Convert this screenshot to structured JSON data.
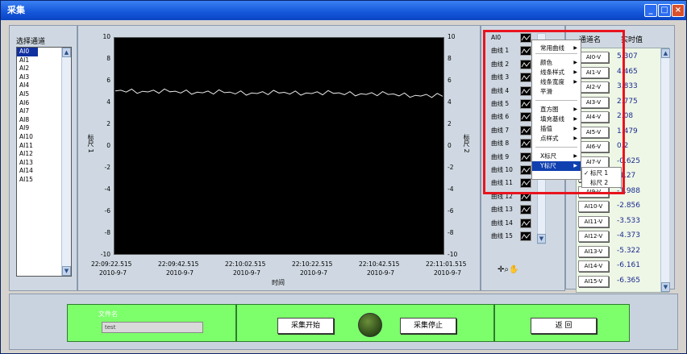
{
  "window": {
    "title": "采集"
  },
  "left": {
    "label": "选择通道",
    "channels": [
      "AI0",
      "AI1",
      "AI2",
      "AI3",
      "AI4",
      "AI5",
      "AI6",
      "AI7",
      "AI8",
      "AI9",
      "AI10",
      "AI11",
      "AI12",
      "AI13",
      "AI14",
      "AI15"
    ]
  },
  "chart": {
    "ylabel_left": "标尺 1",
    "ylabel_right": "标尺 2",
    "xlabel": "时间",
    "yticks": [
      "10",
      "8",
      "6",
      "4",
      "2",
      "0",
      "-2",
      "-4",
      "-6",
      "-8",
      "-10"
    ],
    "xticks": [
      {
        "time": "22:09:22.515",
        "date": "2010-9-7"
      },
      {
        "time": "22:09:42.515",
        "date": "2010-9-7"
      },
      {
        "time": "22:10:02.515",
        "date": "2010-9-7"
      },
      {
        "time": "22:10:22.515",
        "date": "2010-9-7"
      },
      {
        "time": "22:10:42.515",
        "date": "2010-9-7"
      },
      {
        "time": "22:11:01.515",
        "date": "2010-9-7"
      }
    ]
  },
  "chart_data": {
    "type": "line",
    "ylim": [
      -10,
      10
    ],
    "y2lim": [
      -10,
      10
    ],
    "xlabel": "时间",
    "ylabel": "标尺 1",
    "y2label": "标尺 2",
    "x": [
      "22:09:22.515",
      "22:09:42.515",
      "22:10:02.515",
      "22:10:22.515",
      "22:10:42.515",
      "22:11:01.515"
    ],
    "series": [
      {
        "values": [
          5.1,
          5.0,
          4.9,
          4.9,
          4.8,
          4.6
        ]
      }
    ]
  },
  "legend": {
    "items": [
      "AI0",
      "曲线 1",
      "曲线 2",
      "曲线 3",
      "曲线 4",
      "曲线 5",
      "曲线 6",
      "曲线 7",
      "曲线 8",
      "曲线 9",
      "曲线 10",
      "曲线 11",
      "曲线 12",
      "曲线 13",
      "曲线 14",
      "曲线 15"
    ]
  },
  "context_menu": {
    "items": [
      "常用曲线",
      "颜色",
      "线条样式",
      "线条宽度",
      "平滑",
      "直方图",
      "填充基线",
      "插值",
      "点样式",
      "X标尺",
      "Y标尺"
    ],
    "sub": [
      "标尺 1",
      "标尺 2"
    ],
    "checked": "✓"
  },
  "values": {
    "header_name": "通道名",
    "header_value": "实时值",
    "names": [
      "AI0-V",
      "AI1-V",
      "AI2-V",
      "AI3-V",
      "AI4-V",
      "AI5-V",
      "AI6-V",
      "AI7-V",
      "AI8-V",
      "AI9-V",
      "AI10-V",
      "AI11-V",
      "AI12-V",
      "AI13-V",
      "AI14-V",
      "AI15-V"
    ],
    "vals": [
      "5.307",
      "4.465",
      "3.833",
      "2.775",
      "2.08",
      "1.479",
      "0.2",
      "-0.625",
      "-1.27",
      "-1.988",
      "-2.856",
      "-3.533",
      "-4.373",
      "-5.322",
      "-6.161",
      "-6.365"
    ]
  },
  "bottom": {
    "file_label": "文件名",
    "file_value": "test",
    "start": "采集开始",
    "stop": "采集停止",
    "back": "返 回"
  },
  "colors": {
    "accent": "#1456d8",
    "green": "#7dff6b",
    "red": "#e8141e"
  }
}
